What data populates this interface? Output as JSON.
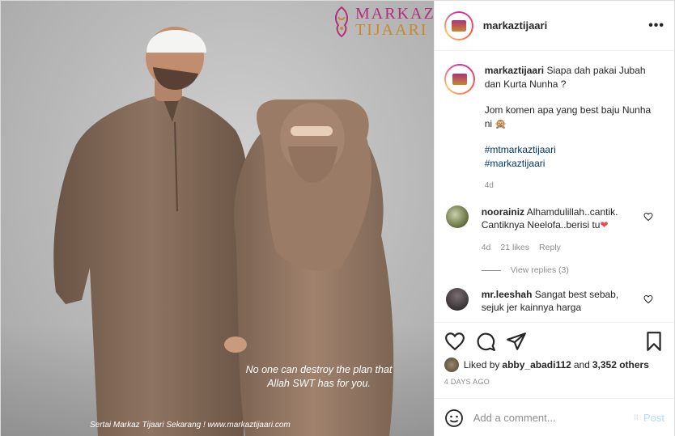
{
  "brand": {
    "line1": "MARKAZ",
    "line2": "TIJAARI"
  },
  "image": {
    "quote_line1": "No one can destroy the plan that",
    "quote_line2": "Allah SWT has for you.",
    "footer": "Sertai Markaz Tijaari Sekarang !   www.markaztijaari.com"
  },
  "header": {
    "username": "markaztijaari",
    "more_icon": "more-dots-icon"
  },
  "caption": {
    "username": "markaztijaari",
    "line1": "Siapa dah pakai Jubah dan Kurta Nunha ?",
    "line2": "Jom komen apa yang best baju Nunha ni 🙊",
    "hashtag1": "#mtmarkaztijaari",
    "hashtag2": "#markaztijaari",
    "age": "4d"
  },
  "comments": [
    {
      "username": "noorainiz",
      "text": "Alhamdulillah..cantik. Cantiknya Neelofa..berisi tu",
      "emoji": "❤",
      "age": "4d",
      "likes": "21 likes",
      "reply": "Reply",
      "view_replies": "View replies (3)"
    },
    {
      "username": "mr.leeshah",
      "text": "Sangat best sebab, sejuk jer kainnya harga"
    }
  ],
  "actions": {
    "icons": [
      "heart-icon",
      "comment-icon",
      "share-icon",
      "bookmark-icon"
    ]
  },
  "likes": {
    "prefix": "Liked by",
    "user": "abby_abadi112",
    "and": "and",
    "others": "3,352 others"
  },
  "post_age": "4 DAYS AGO",
  "add_comment": {
    "placeholder": "Add a comment...",
    "post_label": "Post"
  },
  "colors": {
    "accent": "#0095f6",
    "post_disabled": "#b3dbff",
    "brand_magenta": "#b0307a",
    "brand_gold": "#c58a2e"
  }
}
